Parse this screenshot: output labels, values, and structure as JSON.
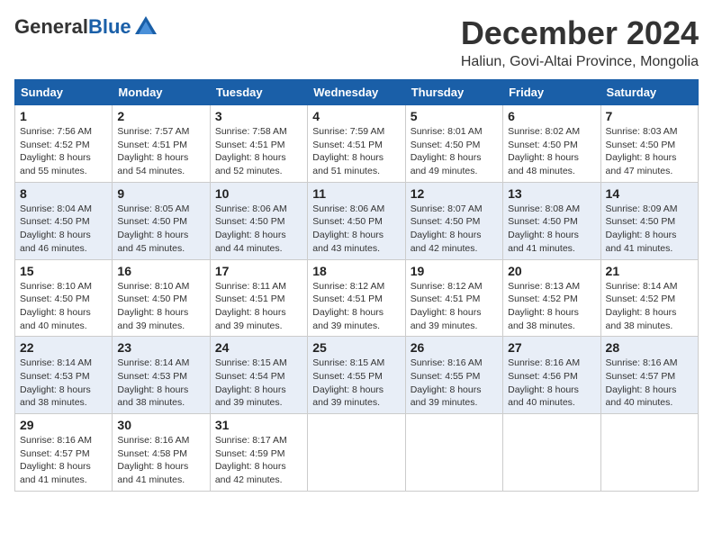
{
  "logo": {
    "general": "General",
    "blue": "Blue"
  },
  "title": "December 2024",
  "subtitle": "Haliun, Govi-Altai Province, Mongolia",
  "weekdays": [
    "Sunday",
    "Monday",
    "Tuesday",
    "Wednesday",
    "Thursday",
    "Friday",
    "Saturday"
  ],
  "weeks": [
    [
      {
        "day": "1",
        "sunrise": "7:56 AM",
        "sunset": "4:52 PM",
        "daylight": "8 hours and 55 minutes."
      },
      {
        "day": "2",
        "sunrise": "7:57 AM",
        "sunset": "4:51 PM",
        "daylight": "8 hours and 54 minutes."
      },
      {
        "day": "3",
        "sunrise": "7:58 AM",
        "sunset": "4:51 PM",
        "daylight": "8 hours and 52 minutes."
      },
      {
        "day": "4",
        "sunrise": "7:59 AM",
        "sunset": "4:51 PM",
        "daylight": "8 hours and 51 minutes."
      },
      {
        "day": "5",
        "sunrise": "8:01 AM",
        "sunset": "4:50 PM",
        "daylight": "8 hours and 49 minutes."
      },
      {
        "day": "6",
        "sunrise": "8:02 AM",
        "sunset": "4:50 PM",
        "daylight": "8 hours and 48 minutes."
      },
      {
        "day": "7",
        "sunrise": "8:03 AM",
        "sunset": "4:50 PM",
        "daylight": "8 hours and 47 minutes."
      }
    ],
    [
      {
        "day": "8",
        "sunrise": "8:04 AM",
        "sunset": "4:50 PM",
        "daylight": "8 hours and 46 minutes."
      },
      {
        "day": "9",
        "sunrise": "8:05 AM",
        "sunset": "4:50 PM",
        "daylight": "8 hours and 45 minutes."
      },
      {
        "day": "10",
        "sunrise": "8:06 AM",
        "sunset": "4:50 PM",
        "daylight": "8 hours and 44 minutes."
      },
      {
        "day": "11",
        "sunrise": "8:06 AM",
        "sunset": "4:50 PM",
        "daylight": "8 hours and 43 minutes."
      },
      {
        "day": "12",
        "sunrise": "8:07 AM",
        "sunset": "4:50 PM",
        "daylight": "8 hours and 42 minutes."
      },
      {
        "day": "13",
        "sunrise": "8:08 AM",
        "sunset": "4:50 PM",
        "daylight": "8 hours and 41 minutes."
      },
      {
        "day": "14",
        "sunrise": "8:09 AM",
        "sunset": "4:50 PM",
        "daylight": "8 hours and 41 minutes."
      }
    ],
    [
      {
        "day": "15",
        "sunrise": "8:10 AM",
        "sunset": "4:50 PM",
        "daylight": "8 hours and 40 minutes."
      },
      {
        "day": "16",
        "sunrise": "8:10 AM",
        "sunset": "4:50 PM",
        "daylight": "8 hours and 39 minutes."
      },
      {
        "day": "17",
        "sunrise": "8:11 AM",
        "sunset": "4:51 PM",
        "daylight": "8 hours and 39 minutes."
      },
      {
        "day": "18",
        "sunrise": "8:12 AM",
        "sunset": "4:51 PM",
        "daylight": "8 hours and 39 minutes."
      },
      {
        "day": "19",
        "sunrise": "8:12 AM",
        "sunset": "4:51 PM",
        "daylight": "8 hours and 39 minutes."
      },
      {
        "day": "20",
        "sunrise": "8:13 AM",
        "sunset": "4:52 PM",
        "daylight": "8 hours and 38 minutes."
      },
      {
        "day": "21",
        "sunrise": "8:14 AM",
        "sunset": "4:52 PM",
        "daylight": "8 hours and 38 minutes."
      }
    ],
    [
      {
        "day": "22",
        "sunrise": "8:14 AM",
        "sunset": "4:53 PM",
        "daylight": "8 hours and 38 minutes."
      },
      {
        "day": "23",
        "sunrise": "8:14 AM",
        "sunset": "4:53 PM",
        "daylight": "8 hours and 38 minutes."
      },
      {
        "day": "24",
        "sunrise": "8:15 AM",
        "sunset": "4:54 PM",
        "daylight": "8 hours and 39 minutes."
      },
      {
        "day": "25",
        "sunrise": "8:15 AM",
        "sunset": "4:55 PM",
        "daylight": "8 hours and 39 minutes."
      },
      {
        "day": "26",
        "sunrise": "8:16 AM",
        "sunset": "4:55 PM",
        "daylight": "8 hours and 39 minutes."
      },
      {
        "day": "27",
        "sunrise": "8:16 AM",
        "sunset": "4:56 PM",
        "daylight": "8 hours and 40 minutes."
      },
      {
        "day": "28",
        "sunrise": "8:16 AM",
        "sunset": "4:57 PM",
        "daylight": "8 hours and 40 minutes."
      }
    ],
    [
      {
        "day": "29",
        "sunrise": "8:16 AM",
        "sunset": "4:57 PM",
        "daylight": "8 hours and 41 minutes."
      },
      {
        "day": "30",
        "sunrise": "8:16 AM",
        "sunset": "4:58 PM",
        "daylight": "8 hours and 41 minutes."
      },
      {
        "day": "31",
        "sunrise": "8:17 AM",
        "sunset": "4:59 PM",
        "daylight": "8 hours and 42 minutes."
      },
      null,
      null,
      null,
      null
    ]
  ],
  "labels": {
    "sunrise_prefix": "Sunrise: ",
    "sunset_prefix": "Sunset: ",
    "daylight_prefix": "Daylight: "
  }
}
